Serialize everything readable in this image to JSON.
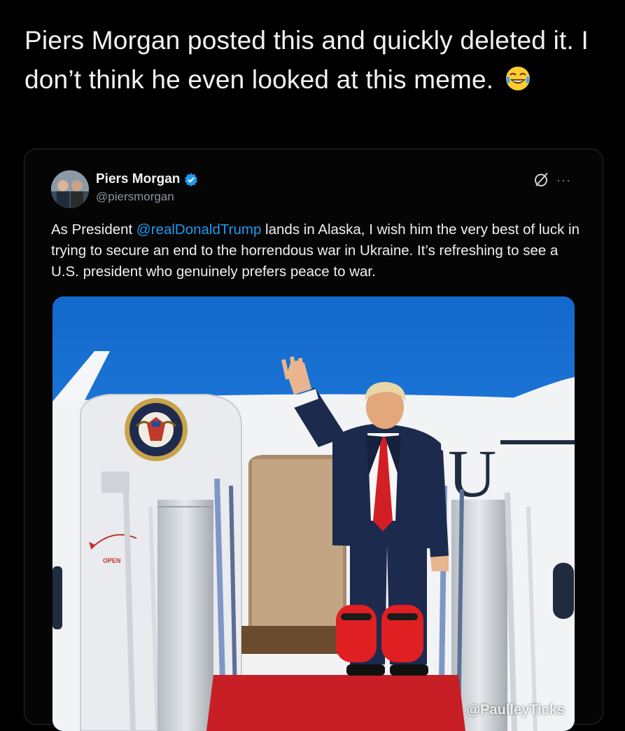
{
  "caption": "Piers Morgan posted this and quickly deleted it. I don’t think he even looked at this meme.",
  "tweet": {
    "author_name": "Piers Morgan",
    "author_handle": "@piersmorgan",
    "text_before": "As President ",
    "mention": "@realDonaldTrump",
    "text_after": " lands in Alaska, I wish him the very best of luck in trying to secure an end to the horrendous war in Ukraine. It’s refreshing to see a U.S. president who genuinely prefers peace to war.",
    "more_label": "···"
  },
  "photo": {
    "door_label": "OPEN",
    "seal_text": "PRESIDENT OF THE UNITED STATES",
    "fuselage_letters": "U",
    "watermark": "@PaulleyTicks"
  },
  "colors": {
    "background": "#000000",
    "mention": "#1d9bf0",
    "verified": "#1d9bf0",
    "sky": "#1a7de0"
  },
  "icons": [
    "laughing-crying-emoji",
    "verified-badge-icon",
    "edit-off-icon",
    "more-icon"
  ]
}
